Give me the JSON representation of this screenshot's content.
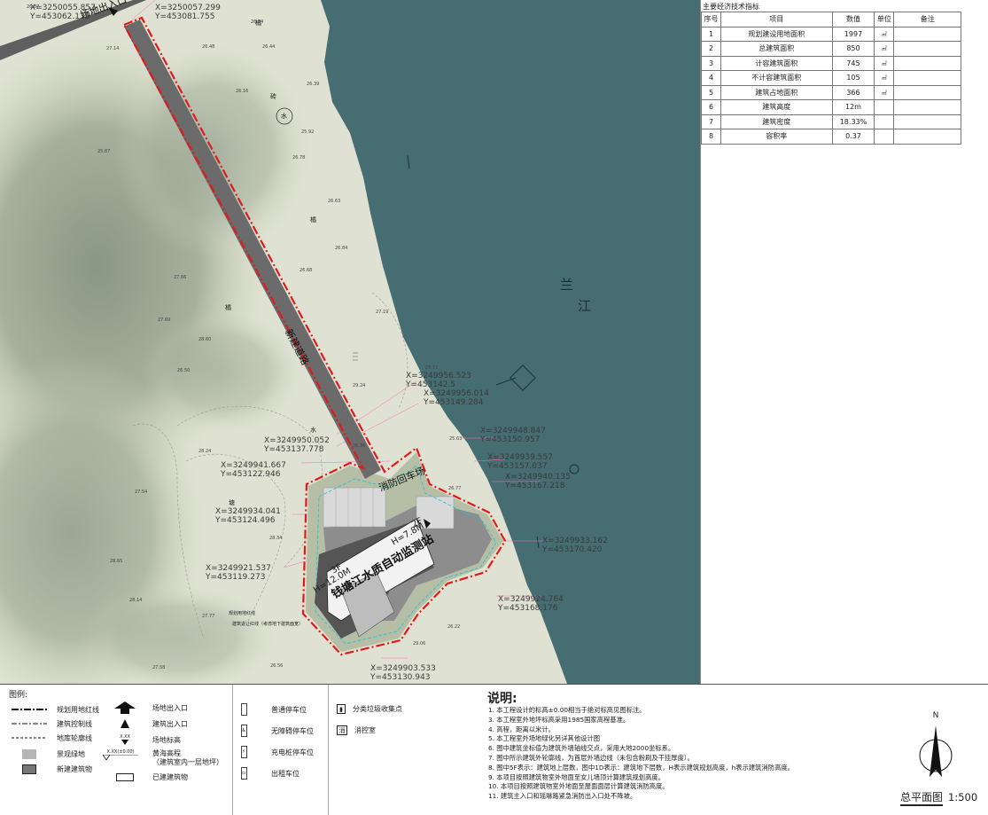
{
  "site": {
    "entrance_label": "场地出入口",
    "road_label": "新建道路",
    "fire_yard_label": "消防回车场",
    "building_label": "钱塘江水质自动监测站",
    "height_a": "H=12.0M",
    "height_b": "H=7.8M",
    "floors_a": "3F",
    "floors_b": "2F",
    "river_name": "兰江",
    "river_char_1": "兰",
    "river_char_2": "江",
    "redline_note": "规划用地红线",
    "control_note": "建筑退让红线（考虑地下建筑面宽）"
  },
  "coordinates": [
    {
      "x": "X=3250057.299",
      "y": "Y=453081.755"
    },
    {
      "x": "X=3250055.857",
      "y": "Y=453062.135"
    },
    {
      "x": "X=3249956.523",
      "y": "Y=453142.5"
    },
    {
      "x": "X=3249956.014",
      "y": "Y=453149.284"
    },
    {
      "x": "X=3249948.847",
      "y": "Y=453150.957"
    },
    {
      "x": "X=3249950.052",
      "y": "Y=453137.778"
    },
    {
      "x": "X=3249941.667",
      "y": "Y=453122.946"
    },
    {
      "x": "X=3249939.557",
      "y": "Y=453157.037"
    },
    {
      "x": "X=3249940.135",
      "y": "Y=453167.218"
    },
    {
      "x": "X=3249934.041",
      "y": "Y=453124.496"
    },
    {
      "x": "X=3249933.162",
      "y": "Y=453170.420"
    },
    {
      "x": "X=3249921.537",
      "y": "Y=453119.273"
    },
    {
      "x": "X=3249924.764",
      "y": "Y=453168.176"
    },
    {
      "x": "X=3249903.533",
      "y": "Y=453130.943"
    }
  ],
  "elevations": [
    "26.87",
    "26.84",
    "26.44",
    "26.48",
    "26.16",
    "26.39",
    "25.92",
    "26.78",
    "26.63",
    "26.84",
    "26.68",
    "27.19",
    "27.66",
    "27.69",
    "25.72",
    "26.50",
    "29.24",
    "26.36",
    "25.63",
    "26.77",
    "28.65",
    "28.14",
    "27.77",
    "29.06",
    "26.22",
    "26.56",
    "27.58",
    "28.60",
    "28.24",
    "27.54",
    "28.34",
    "25.87",
    "27.14"
  ],
  "landmarks": {
    "water_symbol": "水",
    "water_text": "水",
    "orange_1": "橘",
    "orange_2": "橘",
    "orange_3": "橘",
    "brick": "砖",
    "pond": "塘"
  },
  "table": {
    "title": "主要经济技术指标",
    "headers": [
      "序号",
      "项目",
      "数值",
      "单位",
      "备注"
    ],
    "rows": [
      {
        "no": "1",
        "item": "规划建设用地面积",
        "value": "1997",
        "unit": "㎡",
        "note": ""
      },
      {
        "no": "2",
        "item": "总建筑面积",
        "value": "850",
        "unit": "㎡",
        "note": ""
      },
      {
        "no": "3",
        "item": "计容建筑面积",
        "value": "745",
        "unit": "㎡",
        "note": ""
      },
      {
        "no": "4",
        "item": "不计容建筑面积",
        "value": "105",
        "unit": "㎡",
        "note": ""
      },
      {
        "no": "5",
        "item": "建筑占地面积",
        "value": "366",
        "unit": "㎡",
        "note": ""
      },
      {
        "no": "6",
        "item": "建筑高度",
        "value": "12m",
        "unit": "",
        "note": ""
      },
      {
        "no": "7",
        "item": "建筑密度",
        "value": "18.33%",
        "unit": "",
        "note": ""
      },
      {
        "no": "8",
        "item": "容积率",
        "value": "0.37",
        "unit": "",
        "note": ""
      }
    ]
  },
  "legend": {
    "title": "图例:",
    "col1": [
      "规划用地红线",
      "建筑控制线",
      "地库轮廓线",
      "景观绿地",
      "新建建筑物"
    ],
    "col2": [
      "场地出入口",
      "建筑出入口",
      "场地标高",
      "黄海高程",
      "（建筑室内一层地坪）",
      "已建建筑物"
    ],
    "elev_sample": "X.XX",
    "elev_sample_2": "X.XX(±0.00)",
    "col3": [
      "普通停车位",
      "无障碍停车位",
      "充电桩停车位",
      "出租车位"
    ],
    "col4": [
      "分类垃圾收集点",
      "消控室"
    ],
    "col4_icon": "消"
  },
  "notes": {
    "title": "说明:",
    "items": [
      "1. 本工程设计的标高±0.00相当于绝对标高见图标注。",
      "3. 本工程室外地坪标高采用1985国家高程基准。",
      "4. 高程，距离以米计。",
      "5. 本工程室外场地绿化另详其他设计图",
      "6. 图中建筑坐标值为建筑外墙轴线交点，采用大地2000坐标系。",
      "7. 图中所示建筑外轮廓线，为首层外墙边线（未包含粉刷及干挂厚度）。",
      "8. 图中5F表示：建筑地上层数，图中1D表示：建筑地下层数，H表示建筑规划高度，h表示建筑消防高度。",
      "9. 本项目按照建筑物室外地面至女儿墙顶计算建筑规划高度。",
      "10. 本项目按照建筑物室外地面至屋面面层计算建筑消防高度。",
      "11. 建筑主入口和瑶琳路紧急消防出入口处不降坡。"
    ]
  },
  "north_label": "N",
  "plan_title": "总平面图",
  "scale": "1:500",
  "colors": {
    "water": "#466d72",
    "terrain": "#dcdfcc",
    "road": "#6b6b6b",
    "redline": "#e01a1a",
    "green": "#b7bea6"
  }
}
